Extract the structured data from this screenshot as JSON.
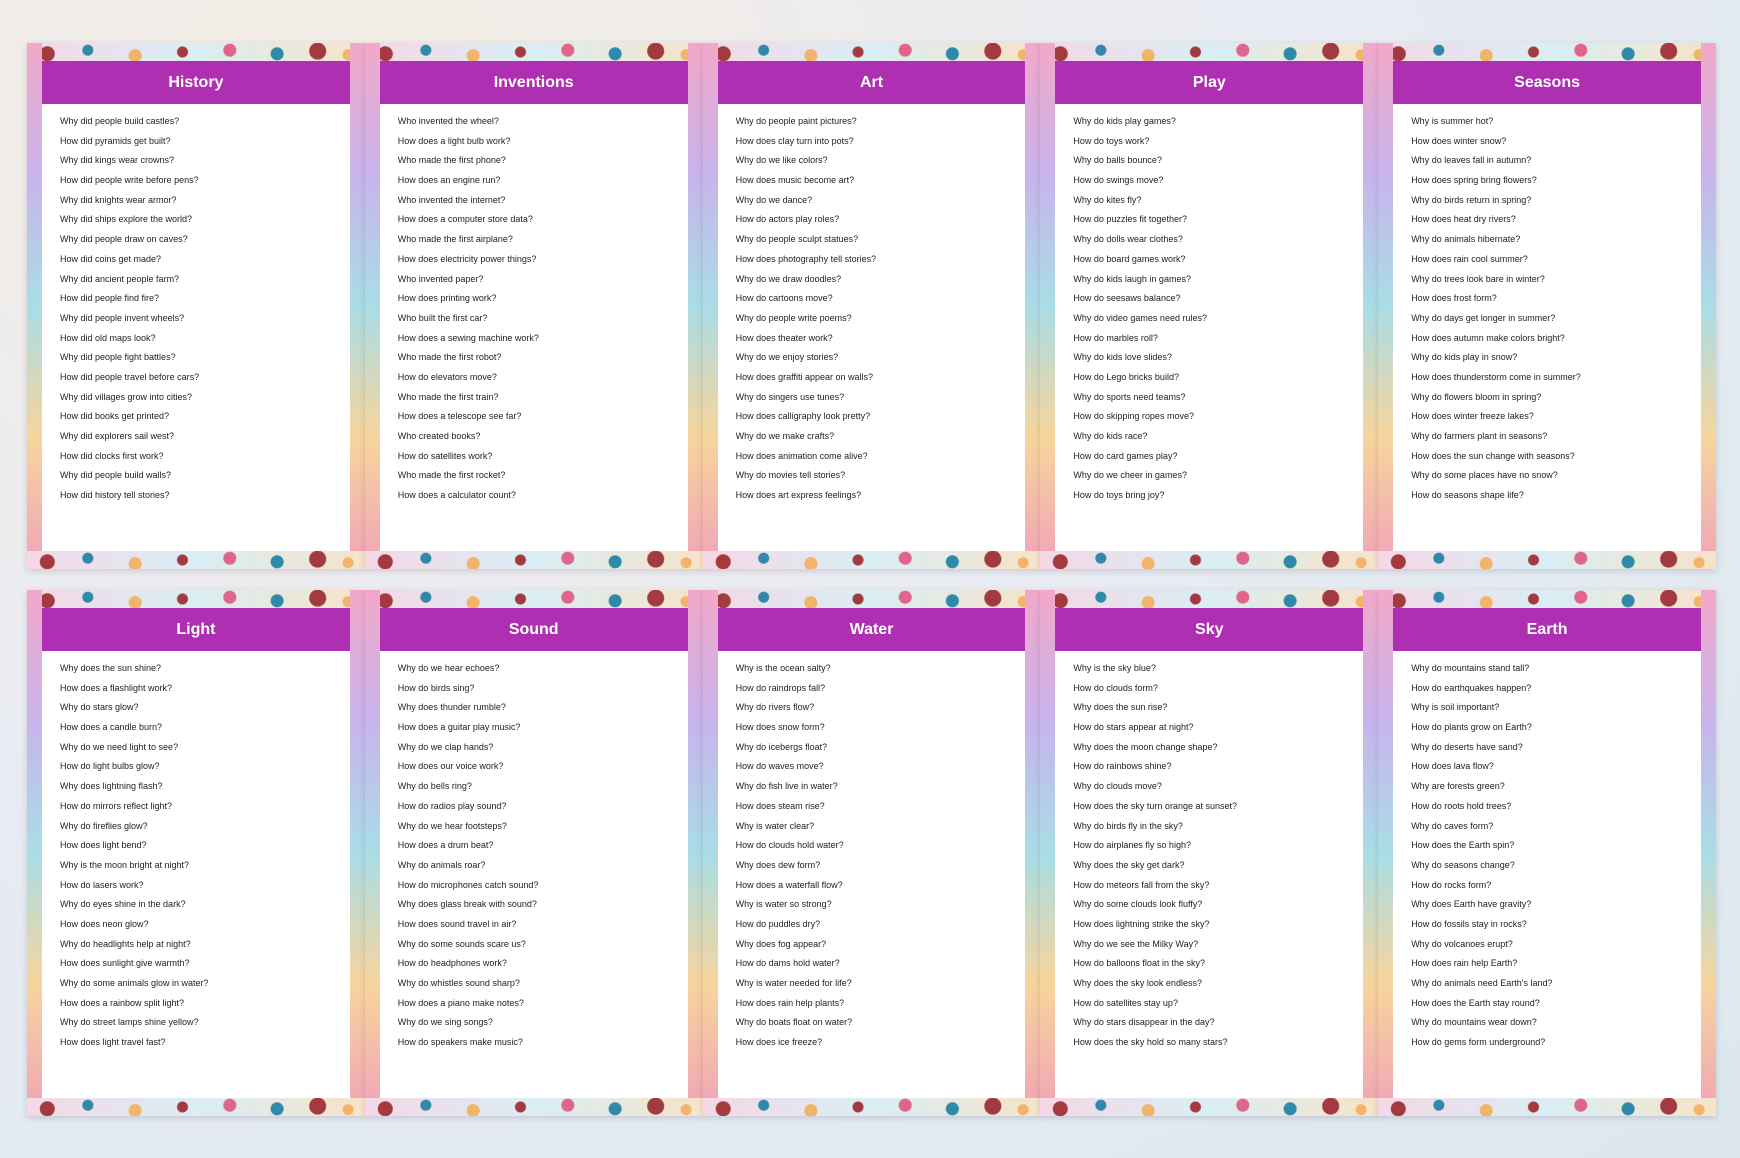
{
  "cards": [
    {
      "title": "History",
      "questions": [
        "Why did people build castles?",
        "How did pyramids get built?",
        "Why did kings wear crowns?",
        "How did people write before pens?",
        "Why did knights wear armor?",
        "Why did ships explore the world?",
        "Why did people draw on caves?",
        "How did coins get made?",
        "Why did ancient people farm?",
        "How did people find fire?",
        "Why did people invent wheels?",
        "How did old maps look?",
        "Why did people fight battles?",
        "How did people travel before cars?",
        "Why did villages grow into cities?",
        "How did books get printed?",
        "Why did explorers sail west?",
        "How did clocks first work?",
        "Why did people build walls?",
        "How did history tell stories?"
      ]
    },
    {
      "title": "Inventions",
      "questions": [
        "Who invented the wheel?",
        "How does a light bulb work?",
        "Who made the first phone?",
        "How does an engine run?",
        "Who invented the internet?",
        "How does a computer store data?",
        "Who made the first airplane?",
        "How does electricity power things?",
        "Who invented paper?",
        "How does printing work?",
        "Who built the first car?",
        "How does a sewing machine work?",
        "Who made the first robot?",
        "How do elevators move?",
        "Who made the first train?",
        "How does a telescope see far?",
        "Who created books?",
        "How do satellites work?",
        "Who made the first rocket?",
        "How does a calculator count?"
      ]
    },
    {
      "title": "Art",
      "questions": [
        "Why do people paint pictures?",
        "How does clay turn into pots?",
        "Why do we like colors?",
        "How does music become art?",
        "Why do we dance?",
        "How do actors play roles?",
        "Why do people sculpt statues?",
        "How does photography tell stories?",
        "Why do we draw doodles?",
        "How do cartoons move?",
        "Why do people write poems?",
        "How does theater work?",
        "Why do we enjoy stories?",
        "How does graffiti appear on walls?",
        "Why do singers use tunes?",
        "How does calligraphy look pretty?",
        "Why do we make crafts?",
        "How does animation come alive?",
        "Why do movies tell stories?",
        "How does art express feelings?"
      ]
    },
    {
      "title": "Play",
      "questions": [
        "Why do kids play games?",
        "How do toys work?",
        "Why do balls bounce?",
        "How do swings move?",
        "Why do kites fly?",
        "How do puzzles fit together?",
        "Why do dolls wear clothes?",
        "How do board games work?",
        "Why do kids laugh in games?",
        "How do seesaws balance?",
        "Why do video games need rules?",
        "How do marbles roll?",
        "Why do kids love slides?",
        "How do Lego bricks build?",
        "Why do sports need teams?",
        "How do skipping ropes move?",
        "Why do kids race?",
        "How do card games play?",
        "Why do we cheer in games?",
        "How do toys bring joy?"
      ]
    },
    {
      "title": "Seasons",
      "questions": [
        "Why is summer hot?",
        "How does winter snow?",
        "Why do leaves fall in autumn?",
        "How does spring bring flowers?",
        "Why do birds return in spring?",
        "How does heat dry rivers?",
        "Why do animals hibernate?",
        "How does rain cool summer?",
        "Why do trees look bare in winter?",
        "How does frost form?",
        "Why do days get longer in summer?",
        "How does autumn make colors bright?",
        "Why do kids play in snow?",
        "How does thunderstorm come in summer?",
        "Why do flowers bloom in spring?",
        "How does winter freeze lakes?",
        "Why do farmers plant in seasons?",
        "How does the sun change with seasons?",
        "Why do some places have no snow?",
        "How do seasons shape life?"
      ]
    },
    {
      "title": "Light",
      "questions": [
        "Why does the sun shine?",
        "How does a flashlight work?",
        "Why do stars glow?",
        "How does a candle burn?",
        "Why do we need light to see?",
        "How do light bulbs glow?",
        "Why does lightning flash?",
        "How do mirrors reflect light?",
        "Why do fireflies glow?",
        "How does light bend?",
        "Why is the moon bright at night?",
        "How do lasers work?",
        "Why do eyes shine in the dark?",
        "How does neon glow?",
        "Why do headlights help at night?",
        "How does sunlight give warmth?",
        "Why do some animals glow in water?",
        "How does a rainbow split light?",
        "Why do street lamps shine yellow?",
        "How does light travel fast?"
      ]
    },
    {
      "title": "Sound",
      "questions": [
        "Why do we hear echoes?",
        "How do birds sing?",
        "Why does thunder rumble?",
        "How does a guitar play music?",
        "Why do we clap hands?",
        "How does our voice work?",
        "Why do bells ring?",
        "How do radios play sound?",
        "Why do we hear footsteps?",
        "How does a drum beat?",
        "Why do animals roar?",
        "How do microphones catch sound?",
        "Why does glass break with sound?",
        "How does sound travel in air?",
        "Why do some sounds scare us?",
        "How do headphones work?",
        "Why do whistles sound sharp?",
        "How does a piano make notes?",
        "Why do we sing songs?",
        "How do speakers make music?"
      ]
    },
    {
      "title": "Water",
      "questions": [
        "Why is the ocean salty?",
        "How do raindrops fall?",
        "Why do rivers flow?",
        "How does snow form?",
        "Why do icebergs float?",
        "How do waves move?",
        "Why do fish live in water?",
        "How does steam rise?",
        "Why is water clear?",
        "How do clouds hold water?",
        "Why does dew form?",
        "How does a waterfall flow?",
        "Why is water so strong?",
        "How do puddles dry?",
        "Why does fog appear?",
        "How do dams hold water?",
        "Why is water needed for life?",
        "How does rain help plants?",
        "Why do boats float on water?",
        "How does ice freeze?"
      ]
    },
    {
      "title": "Sky",
      "questions": [
        "Why is the sky blue?",
        "How do clouds form?",
        "Why does the sun rise?",
        "How do stars appear at night?",
        "Why does the moon change shape?",
        "How do rainbows shine?",
        "Why do clouds move?",
        "How does the sky turn orange at sunset?",
        "Why do birds fly in the sky?",
        "How do airplanes fly so high?",
        "Why does the sky get dark?",
        "How do meteors fall from the sky?",
        "Why do some clouds look fluffy?",
        "How does lightning strike the sky?",
        "Why do we see the Milky Way?",
        "How do balloons float in the sky?",
        "Why does the sky look endless?",
        "How do satellites stay up?",
        "Why do stars disappear in the day?",
        "How does the sky hold so many stars?"
      ]
    },
    {
      "title": "Earth",
      "questions": [
        "Why do mountains stand tall?",
        "How do earthquakes happen?",
        "Why is soil important?",
        "How do plants grow on Earth?",
        "Why do deserts have sand?",
        "How does lava flow?",
        "Why are forests green?",
        "How do roots hold trees?",
        "Why do caves form?",
        "How does the Earth spin?",
        "Why do seasons change?",
        "How do rocks form?",
        "Why does Earth have gravity?",
        "How do fossils stay in rocks?",
        "Why do volcanoes erupt?",
        "How does rain help Earth?",
        "Why do animals need Earth's land?",
        "How does the Earth stay round?",
        "Why do mountains wear down?",
        "How do gems form underground?"
      ]
    }
  ]
}
